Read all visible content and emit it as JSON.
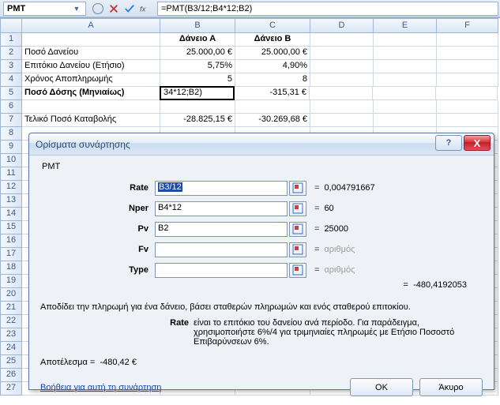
{
  "namebox": "PMT",
  "formula": "=PMT(B3/12;B4*12;B2)",
  "columns": [
    "A",
    "B",
    "C",
    "D",
    "E",
    "F"
  ],
  "sheet": {
    "r1": {
      "B": "Δάνειο Α",
      "C": "Δάνειο Β"
    },
    "r2": {
      "A": "Ποσό Δανείου",
      "B": "25.000,00 €",
      "C": "25.000,00 €"
    },
    "r3": {
      "A": "Επιτόκιο Δανείου (Ετήσιο)",
      "B": "5,75%",
      "C": "4,90%"
    },
    "r4": {
      "A": "Χρόνος Αποπληρωμής",
      "B": "5",
      "C": "8"
    },
    "r5": {
      "A": "Ποσό Δόσης (Μηνιαίως)",
      "B": "34*12;B2)",
      "C": "-315,31 €"
    },
    "r7": {
      "A": "Τελικό Ποσό Καταβολής",
      "B": "-28.825,15 €",
      "C": "-30.269,68 €"
    }
  },
  "dialog": {
    "title": "Ορίσματα συνάρτησης",
    "func": "PMT",
    "args": {
      "rate": {
        "label": "Rate",
        "input_prefix": "",
        "input_sel": "B3/12",
        "result": "0,004791667"
      },
      "nper": {
        "label": "Nper",
        "input": "B4*12",
        "result": "60"
      },
      "pv": {
        "label": "Pv",
        "input": "B2",
        "result": "25000"
      },
      "fv": {
        "label": "Fv",
        "input": "",
        "result": "αριθμός"
      },
      "type": {
        "label": "Type",
        "input": "",
        "result": "αριθμός"
      }
    },
    "func_result": "-480,4192053",
    "desc1": "Αποδίδει την πληρωμή για ένα δάνειο, βάσει σταθερών πληρωμών και ενός σταθερού επιτοκίου.",
    "desc2_label": "Rate",
    "desc2_text": "είναι το επιτόκιο του δανείου ανά περίοδο. Για παράδειγμα, χρησιμοποιήστε 6%/4 για τριμηνιαίες πληρωμές με Ετήσιο Ποσοστό Επιβαρύνσεων 6%.",
    "result_label": "Αποτέλεσμα =",
    "result_value": "-480,42 €",
    "help": "Βοήθεια για αυτή τη συνάρτηση",
    "ok": "OK",
    "cancel": "Άκυρο",
    "help_icon": "?",
    "close_icon": "X"
  }
}
